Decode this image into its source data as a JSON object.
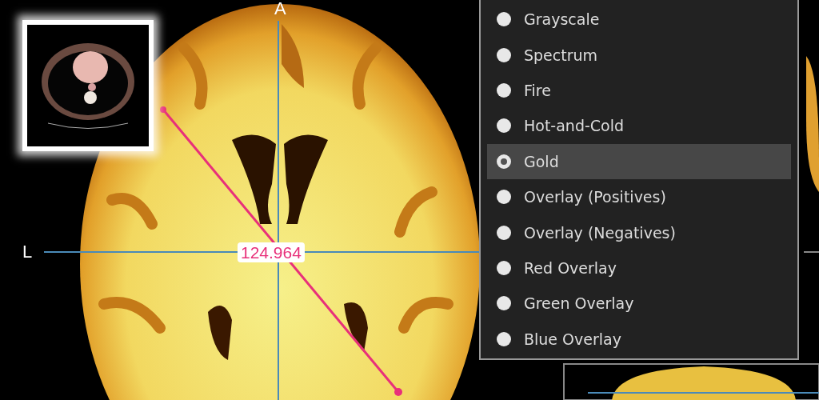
{
  "viewer": {
    "top_label": "A",
    "left_label": "L",
    "measurement": "124.964"
  },
  "color_map_menu": {
    "items": [
      {
        "label": "Grayscale",
        "selected": false
      },
      {
        "label": "Spectrum",
        "selected": false
      },
      {
        "label": "Fire",
        "selected": false
      },
      {
        "label": "Hot-and-Cold",
        "selected": false
      },
      {
        "label": "Gold",
        "selected": true
      },
      {
        "label": "Overlay (Positives)",
        "selected": false
      },
      {
        "label": "Overlay (Negatives)",
        "selected": false
      },
      {
        "label": "Red Overlay",
        "selected": false
      },
      {
        "label": "Green Overlay",
        "selected": false
      },
      {
        "label": "Blue Overlay",
        "selected": false
      }
    ]
  }
}
